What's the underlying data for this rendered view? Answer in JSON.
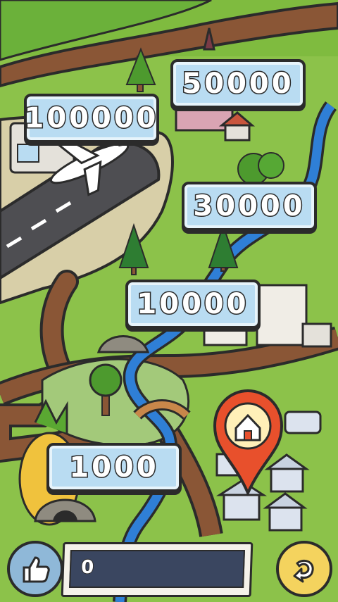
{
  "levels": [
    {
      "id": "level-50000",
      "label": "50000"
    },
    {
      "id": "level-100000",
      "label": "100000"
    },
    {
      "id": "level-30000",
      "label": "30000"
    },
    {
      "id": "level-10000",
      "label": "10000"
    },
    {
      "id": "level-1000",
      "label": "1000"
    }
  ],
  "score": {
    "value": "0"
  },
  "icons": {
    "like": "thumbs-up-icon",
    "back": "back-arrow-icon",
    "marker": "home-pin-icon"
  },
  "colors": {
    "grass": "#8cc24a",
    "road": "#7a4a2e",
    "water": "#2f7fd6",
    "sign": "#b9dcf2",
    "pin": "#e8502c",
    "bar": "#3a4660"
  }
}
